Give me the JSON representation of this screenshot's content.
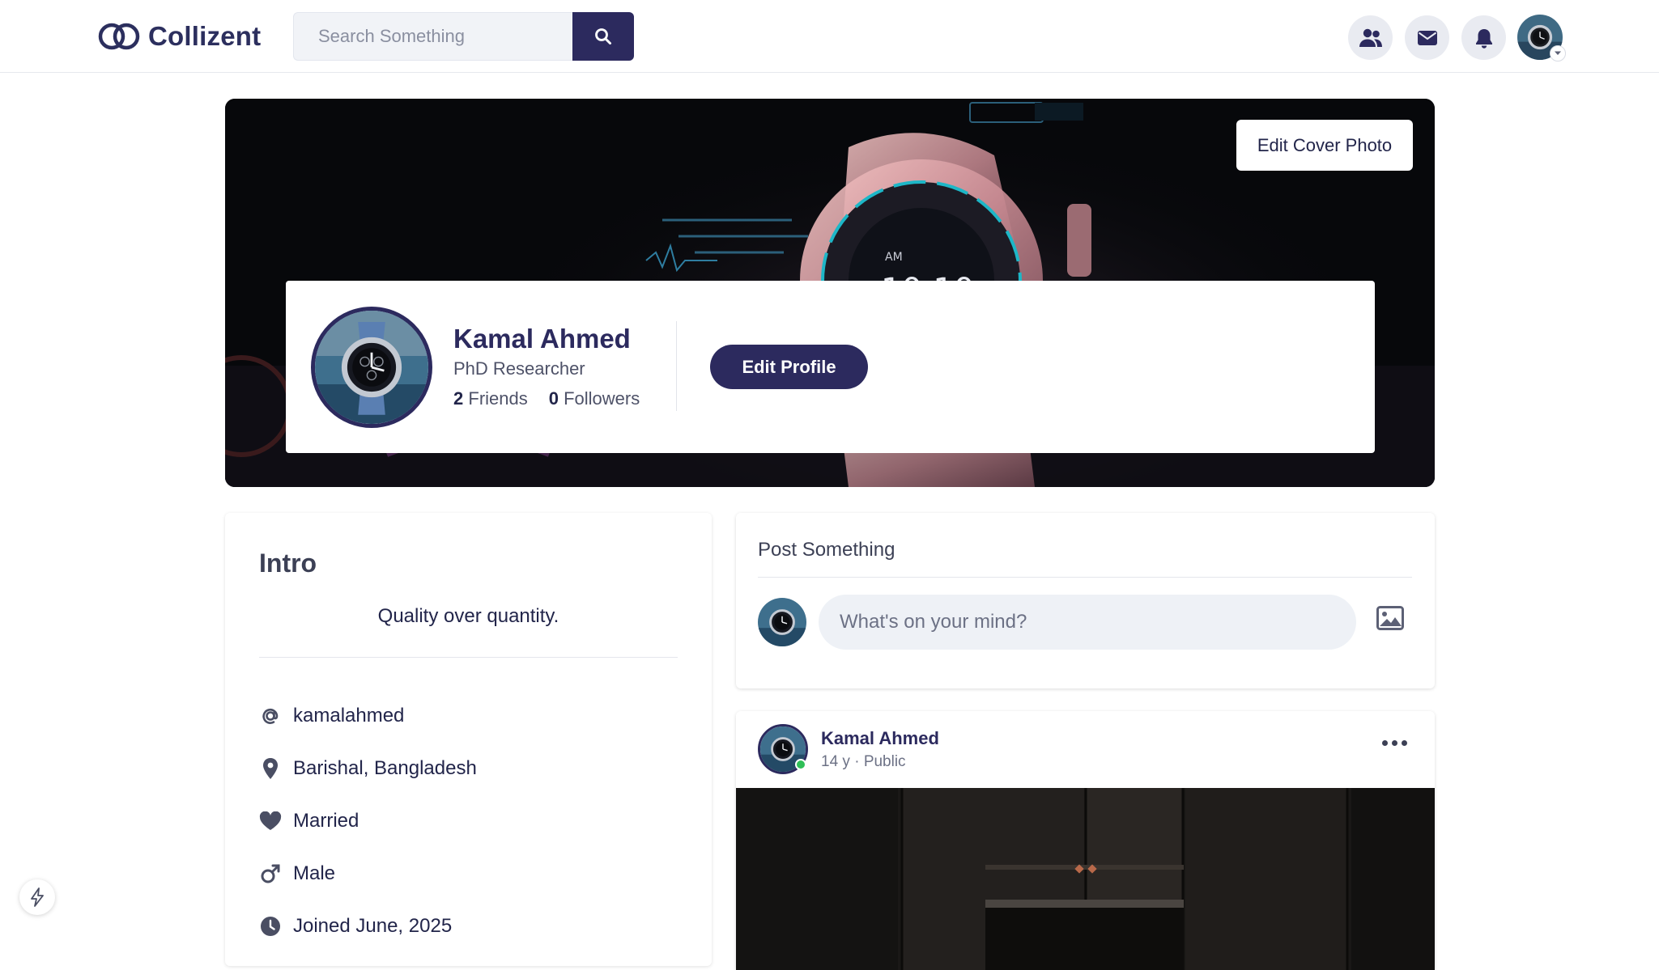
{
  "header": {
    "brand": "Collizent",
    "search": {
      "placeholder": "Search Something",
      "value": ""
    },
    "icons": [
      "search-icon",
      "friends-icon",
      "mail-icon",
      "bell-icon",
      "chevron-down-icon"
    ]
  },
  "cover": {
    "edit_cover_label": "Edit Cover Photo"
  },
  "profile": {
    "name": "Kamal Ahmed",
    "title": "PhD Researcher",
    "friends_count": "2",
    "friends_label": "Friends",
    "followers_count": "0",
    "followers_label": "Followers",
    "edit_profile_label": "Edit Profile"
  },
  "intro": {
    "title": "Intro",
    "bio": "Quality over quantity.",
    "items": [
      {
        "icon": "at-icon",
        "text": "kamalahmed"
      },
      {
        "icon": "location-pin-icon",
        "text": "Barishal, Bangladesh"
      },
      {
        "icon": "heart-icon",
        "text": "Married"
      },
      {
        "icon": "male-icon",
        "text": "Male"
      },
      {
        "icon": "clock-icon",
        "text": "Joined June, 2025"
      }
    ]
  },
  "composer": {
    "title": "Post Something",
    "placeholder": "What's on your mind?"
  },
  "post": {
    "author": "Kamal Ahmed",
    "time": "14 y",
    "separator": "·",
    "visibility": "Public"
  },
  "colors": {
    "brand": "#2c2a5e",
    "online": "#2fbf57",
    "field_bg": "#eef1f6"
  }
}
